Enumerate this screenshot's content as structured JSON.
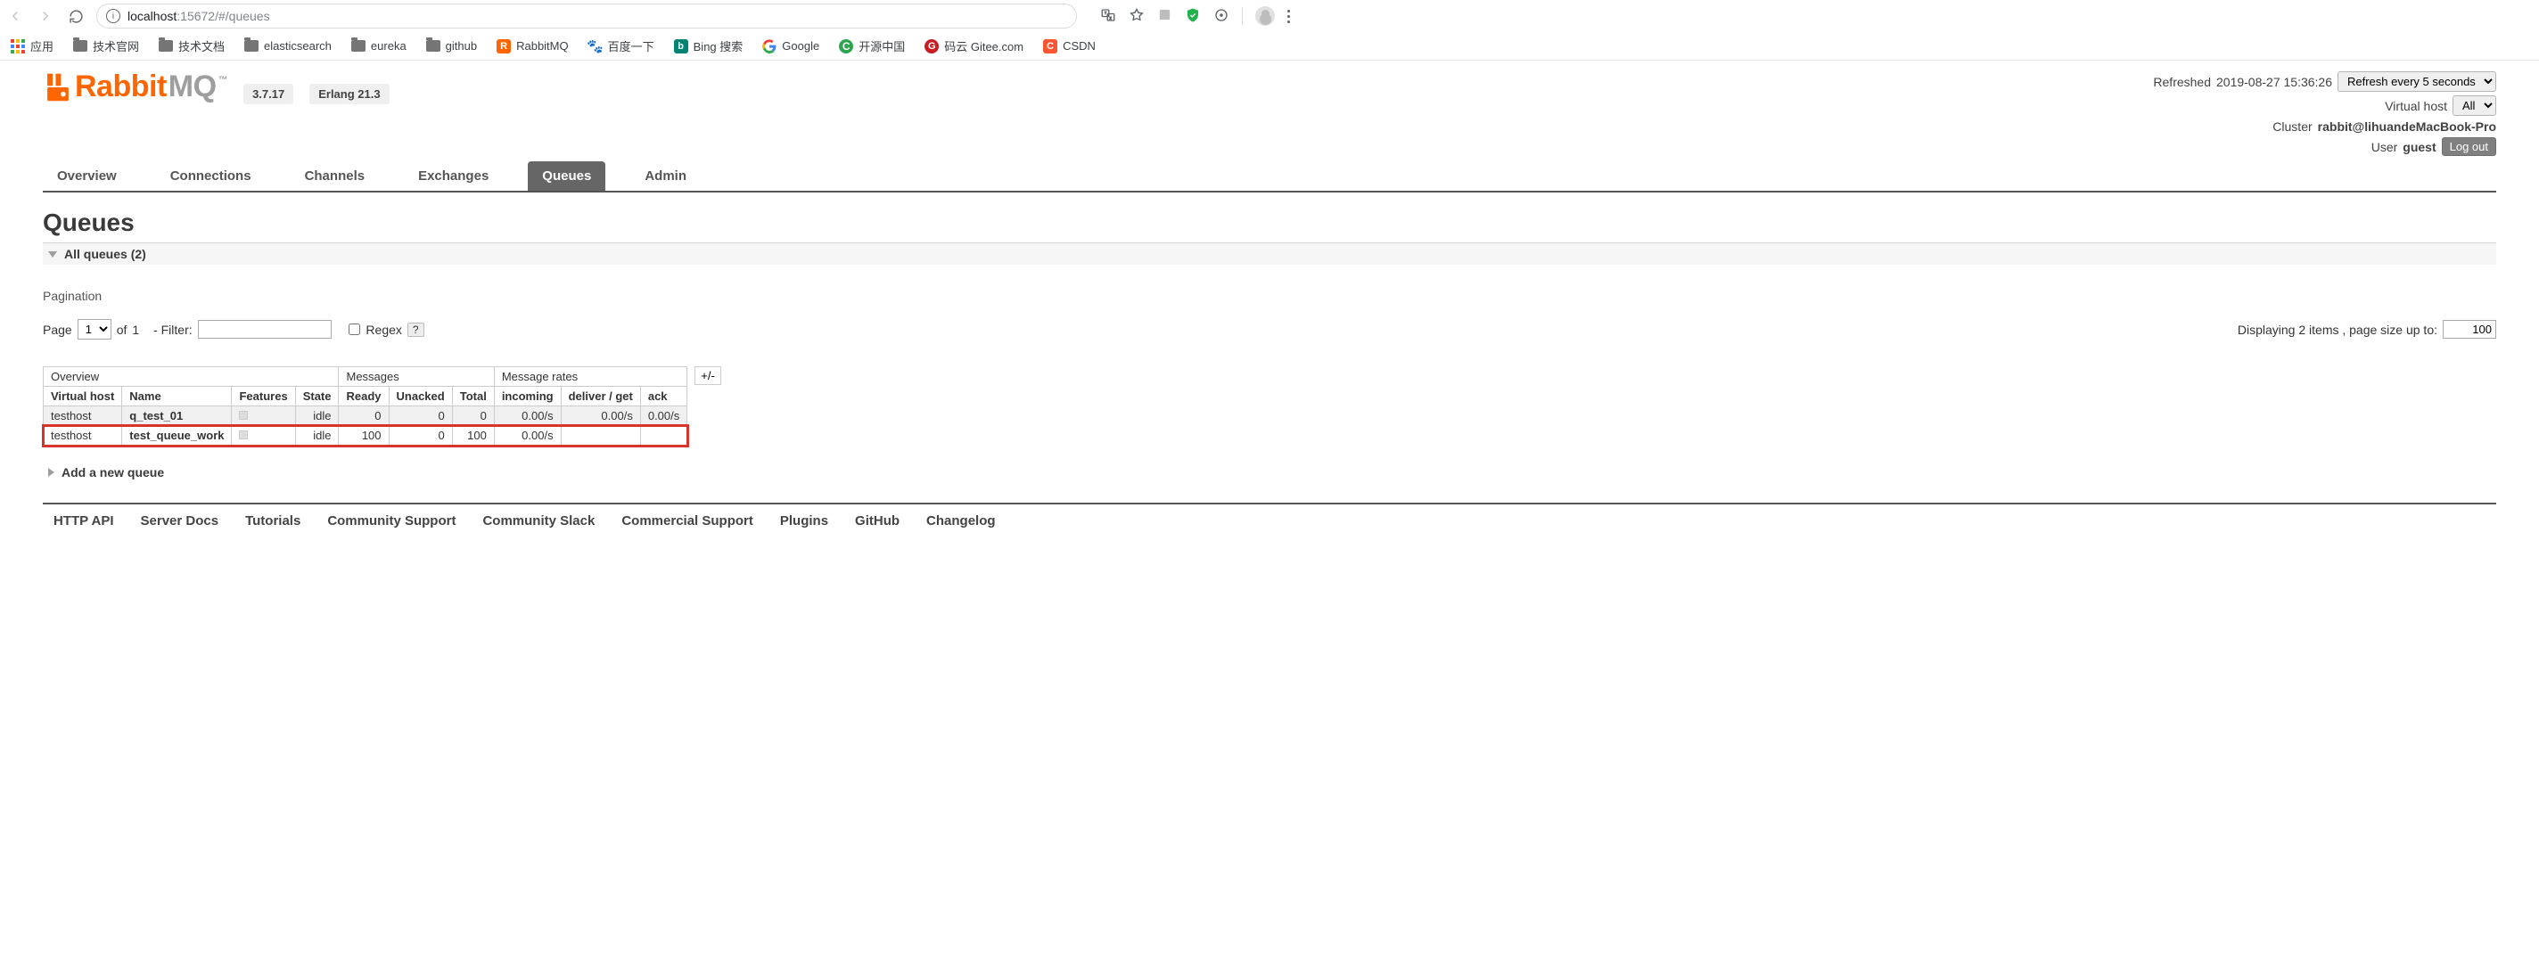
{
  "browser": {
    "url_host": "localhost",
    "url_port": ":15672",
    "url_path": "/#/queues"
  },
  "bookmarks": {
    "apps": "应用",
    "items": [
      {
        "label": "技术官网",
        "kind": "folder"
      },
      {
        "label": "技术文档",
        "kind": "folder"
      },
      {
        "label": "elasticsearch",
        "kind": "folder"
      },
      {
        "label": "eureka",
        "kind": "folder"
      },
      {
        "label": "github",
        "kind": "folder"
      },
      {
        "label": "RabbitMQ",
        "kind": "orange"
      },
      {
        "label": "百度一下",
        "kind": "paw"
      },
      {
        "label": "Bing 搜索",
        "kind": "bing"
      },
      {
        "label": "Google",
        "kind": "google"
      },
      {
        "label": "开源中国",
        "kind": "oschina"
      },
      {
        "label": "码云 Gitee.com",
        "kind": "gitee"
      },
      {
        "label": "CSDN",
        "kind": "csdn"
      }
    ]
  },
  "header": {
    "brand_a": "Rabbit",
    "brand_b": "MQ",
    "version": "3.7.17",
    "erlang": "Erlang 21.3",
    "refreshed_label": "Refreshed",
    "refreshed_at": "2019-08-27 15:36:26",
    "refresh_select": "Refresh every 5 seconds",
    "vhost_label": "Virtual host",
    "vhost_value": "All",
    "cluster_label": "Cluster",
    "cluster_value": "rabbit@lihuandeMacBook-Pro",
    "user_label": "User",
    "user_value": "guest",
    "logout": "Log out"
  },
  "tabs": [
    "Overview",
    "Connections",
    "Channels",
    "Exchanges",
    "Queues",
    "Admin"
  ],
  "active_tab": "Queues",
  "title": "Queues",
  "all_queues": {
    "label": "All queues",
    "count": "(2)"
  },
  "pagination": {
    "label": "Pagination",
    "page_word": "Page",
    "of_word": "of",
    "total_pages": "1",
    "filter_label": "- Filter:",
    "regex_label": "Regex",
    "help": "?",
    "page_select": "1",
    "right_text_a": "Displaying",
    "right_count": "2",
    "right_text_b": "items , page size up to:",
    "page_size": "100"
  },
  "table": {
    "group_headers": [
      "Overview",
      "Messages",
      "Message rates"
    ],
    "group_spans": [
      4,
      3,
      3
    ],
    "headers": [
      "Virtual host",
      "Name",
      "Features",
      "State",
      "Ready",
      "Unacked",
      "Total",
      "incoming",
      "deliver / get",
      "ack"
    ],
    "rows": [
      {
        "vhost": "testhost",
        "name": "q_test_01",
        "state": "idle",
        "ready": "0",
        "unacked": "0",
        "total": "0",
        "incoming": "0.00/s",
        "deliver": "0.00/s",
        "ack": "0.00/s",
        "highlight": false,
        "odd": true
      },
      {
        "vhost": "testhost",
        "name": "test_queue_work",
        "state": "idle",
        "ready": "100",
        "unacked": "0",
        "total": "100",
        "incoming": "0.00/s",
        "deliver": "",
        "ack": "",
        "highlight": true,
        "odd": false
      }
    ],
    "plusminus": "+/-"
  },
  "add_queue": "Add a new queue",
  "footer": [
    "HTTP API",
    "Server Docs",
    "Tutorials",
    "Community Support",
    "Community Slack",
    "Commercial Support",
    "Plugins",
    "GitHub",
    "Changelog"
  ]
}
